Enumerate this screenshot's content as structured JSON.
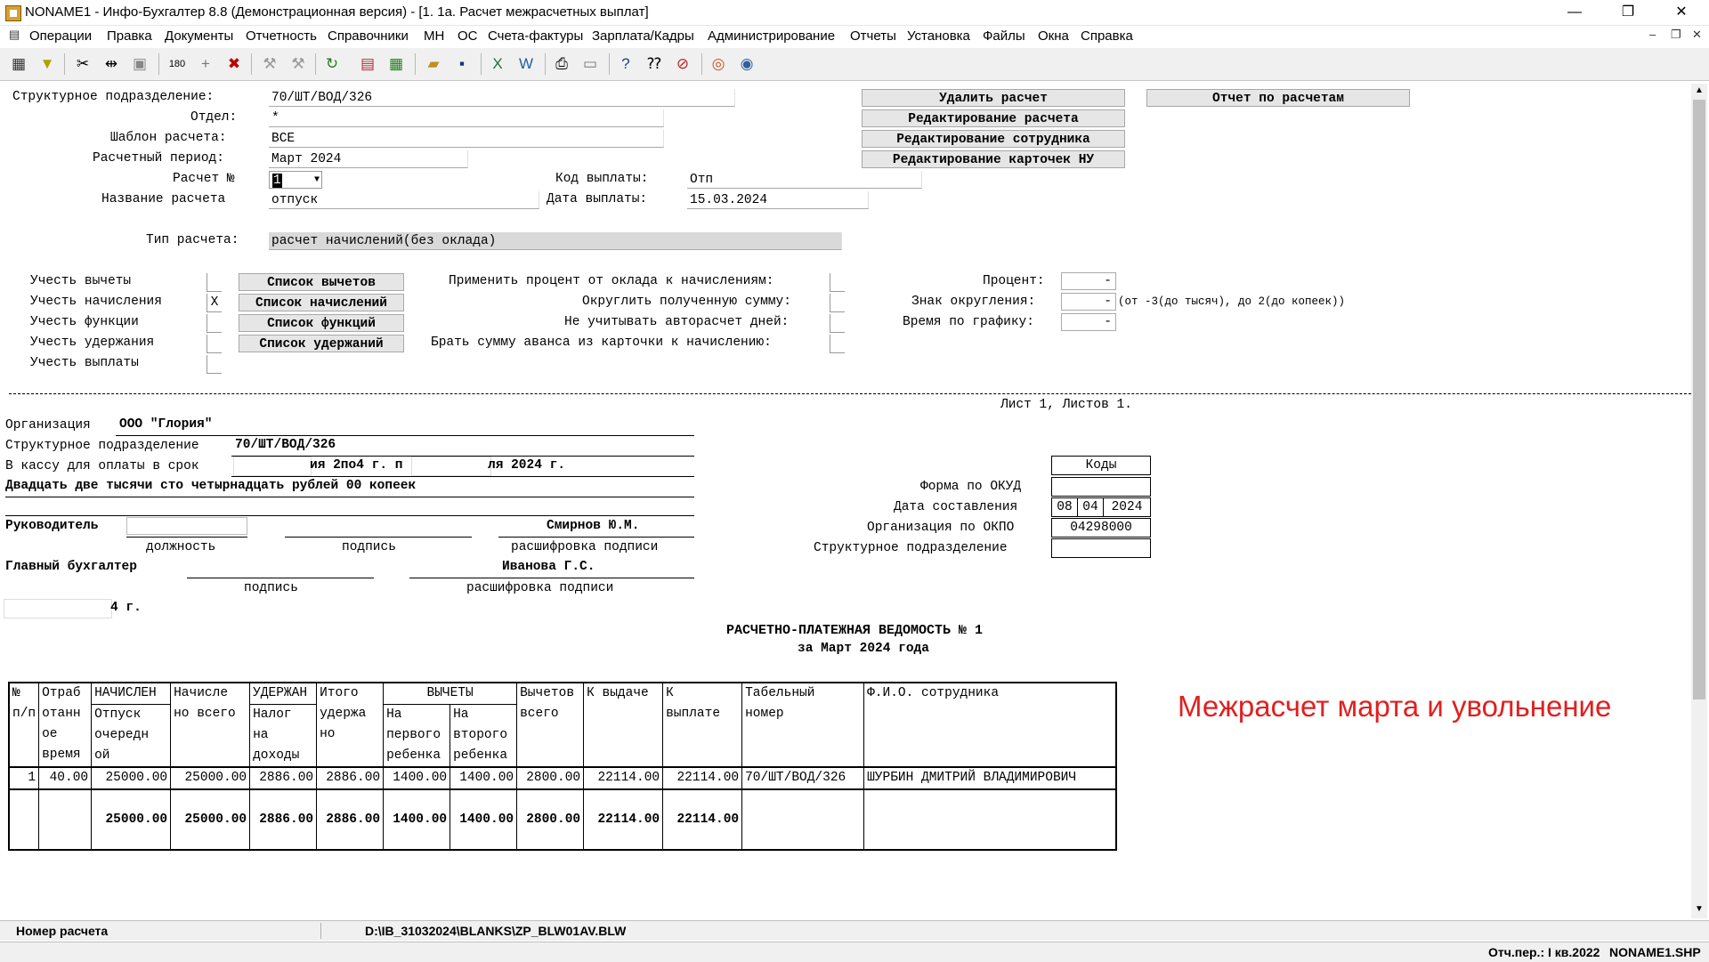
{
  "window": {
    "title": "NONAME1 - Инфо-Бухгалтер 8.8 (Демонстрационная версия) - [1. 1а. Расчет межрасчетных выплат]",
    "minimize": "—",
    "restore": "❐",
    "close": "✕"
  },
  "menu": {
    "items": [
      "Операции",
      "Правка",
      "Документы",
      "Отчетность",
      "Справочники",
      "МН",
      "ОС",
      "Счета-фактуры",
      "Зарплата/Кадры",
      "Администрирование",
      "Отчеты",
      "Установка",
      "Файлы",
      "Окна",
      "Справка"
    ],
    "mdi_minimize": "–",
    "mdi_restore": "❐",
    "mdi_close": "✕"
  },
  "form": {
    "struct_label": "Структурное подразделение:",
    "struct_value": "70/ШТ/ВОД/326",
    "dept_label": "Отдел:",
    "dept_value": "*",
    "template_label": "Шаблон расчета:",
    "template_value": "ВСЕ",
    "period_label": "Расчетный период:",
    "period_value": "Март 2024",
    "calc_no_label": "Расчет №",
    "calc_no_value": "1",
    "calc_name_label": "Название расчета",
    "calc_name_value": "отпуск",
    "pay_code_label": "Код выплаты:",
    "pay_code_value": "Отп",
    "pay_date_label": "Дата выплаты:",
    "pay_date_value": "15.03.2024",
    "calc_type_label": "Тип расчета:",
    "calc_type_value": "расчет начислений(без оклада)",
    "buttons": {
      "delete": "Удалить расчет",
      "edit_calc": "Редактирование расчета",
      "edit_employee": "Редактирование сотрудника",
      "edit_cards": "Редактирование карточек НУ",
      "report": "Отчет по расчетам",
      "deductions_list": "Список вычетов",
      "accruals_list": "Список начислений",
      "functions_list": "Список функций",
      "withholdings_list": "Список удержаний"
    },
    "checks": {
      "deductions": {
        "label": "Учесть вычеты",
        "value": ""
      },
      "accruals": {
        "label": "Учесть начисления",
        "value": "X"
      },
      "functions": {
        "label": "Учесть функции",
        "value": ""
      },
      "withholdings": {
        "label": "Учесть удержания",
        "value": ""
      },
      "payments": {
        "label": "Учесть выплаты",
        "value": ""
      }
    },
    "options": {
      "apply_percent": "Применить процент от оклада к начислениям:",
      "round_sum": "Округлить полученную сумму:",
      "ignore_autocalc": "Не учитывать авторасчет дней:",
      "advance_from_card": "Брать сумму аванса из карточки к начислению:"
    },
    "right": {
      "percent_label": "Процент:",
      "round_sign_label": "Знак округления:",
      "round_hint": "(от -3(до тысяч), до 2(до копеек))",
      "schedule_label": "Время по графику:",
      "empty_value": "-"
    }
  },
  "report": {
    "sheet": "Лист 1, Листов 1.",
    "org_label": "Организация",
    "org_value": "ООО \"Глория\"",
    "struct_label": "Структурное подразделение",
    "struct_value": "70/ШТ/ВОД/326",
    "cash_label": "В кассу для оплаты в срок",
    "cash_mid": "ия 2по4 г. п",
    "cash_end": "ля 2024 г.",
    "amount_words": "Двадцать две тысячи сто четырнадцать рублей 00 копеек",
    "head_label": "Руководитель",
    "head_name": "Смирнов Ю.М.",
    "position_caption": "должность",
    "signature_caption": "подпись",
    "decoding_caption": "расшифровка подписи",
    "chief_label": "Главный бухгалтер",
    "chief_name": "Иванова Г.С.",
    "date_suffix": "4 г.",
    "codes_header": "Коды",
    "okud_label": "Форма по ОКУД",
    "date_label": "Дата составления",
    "date_d": "08",
    "date_m": "04",
    "date_y": "2024",
    "okpo_label": "Организация по ОКПО",
    "okpo_value": "04298000",
    "struct_code_label": "Структурное подразделение",
    "doc_title": "РАСЧЕТНО-ПЛАТЕЖНАЯ ВЕДОМОСТЬ № 1",
    "doc_subtitle": "за Март 2024 года"
  },
  "table": {
    "h": {
      "np": [
        "№",
        "п/п"
      ],
      "worked": [
        "Отраб",
        "отанн",
        "ое",
        "время"
      ],
      "accrued": "НАЧИСЛЕН",
      "vacation": [
        "Отпуск",
        "очередн",
        "ой"
      ],
      "accrued_total": [
        "Начисле",
        "но всего"
      ],
      "withheld": "УДЕРЖАН",
      "tax": [
        "Налог",
        "на",
        "доходы"
      ],
      "withheld_total": [
        "Итого",
        "удержа",
        "но"
      ],
      "deductions": "ВЫЧЕТЫ",
      "first_child": [
        "На",
        "первого",
        "ребенка"
      ],
      "second_child": [
        "На",
        "второго",
        "ребенка"
      ],
      "deductions_total": [
        "Вычетов",
        "всего"
      ],
      "to_issue": "К выдаче",
      "to_pay": [
        "К",
        "выплате"
      ],
      "tab_no": [
        "Табельный",
        "номер"
      ],
      "fio": "Ф.И.О. сотрудника"
    },
    "row": {
      "n": "1",
      "worked": "40.00",
      "vacation": "25000.00",
      "accrued_total": "25000.00",
      "tax": "2886.00",
      "withheld_total": "2886.00",
      "first_child": "1400.00",
      "second_child": "1400.00",
      "deductions_total": "2800.00",
      "to_issue": "22114.00",
      "to_pay": "22114.00",
      "tab_no": "70/ШТ/ВОД/326",
      "fio": "ШУРБИН ДМИТРИЙ ВЛАДИМИРОВИЧ"
    },
    "total": {
      "vacation": "25000.00",
      "accrued_total": "25000.00",
      "tax": "2886.00",
      "withheld_total": "2886.00",
      "first_child": "1400.00",
      "second_child": "1400.00",
      "deductions_total": "2800.00",
      "to_issue": "22114.00",
      "to_pay": "22114.00"
    }
  },
  "annotation": "Межрасчет марта и увольнение",
  "status": {
    "field": "Номер расчета",
    "path": "D:\\IB_31032024\\BLANKS\\ZP_BLW01AV.BLW",
    "period": "Отч.пер.: I кв.2022",
    "file": "NONAME1.SHP"
  }
}
